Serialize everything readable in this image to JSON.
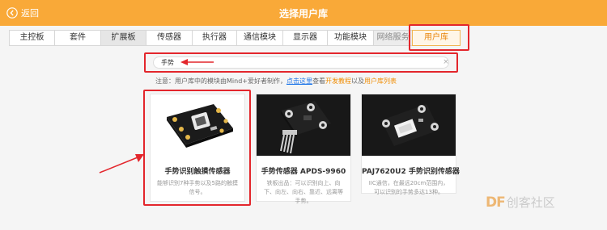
{
  "header": {
    "back_label": "返回",
    "title": "选择用户库"
  },
  "tabs": [
    "主控板",
    "套件",
    "扩展板",
    "传感器",
    "执行器",
    "通信模块",
    "显示器",
    "功能模块",
    "网络服务",
    "用户库"
  ],
  "search": {
    "value": "手势",
    "clear_symbol": "×"
  },
  "notice": {
    "prefix": "注意：用户库中的模块由Mind+爱好者制作，",
    "link": "点击这里",
    "middle": "查看",
    "dev_docs": "开发教程",
    "and": "以及",
    "user_list": "用户库列表"
  },
  "cards": [
    {
      "name": "手势识别触摸传感器",
      "desc": "能够识别7种手势以及5路的触摸信号。"
    },
    {
      "name": "手势传感器 APDS-9960",
      "desc": "铁板出品：可以识别向上、向下、向左、向右、靠近、远离等手势。"
    },
    {
      "name": "PAJ7620U2 手势识别传感器",
      "desc": "IIC通信，在最远20cm范围内，可以识别的手势多达13种。"
    }
  ],
  "watermark": {
    "df": "DF",
    "text": "创客社区"
  },
  "colors": {
    "header": "#f9a938",
    "highlight": "#e3262c",
    "active_tab": "#e8860c"
  }
}
